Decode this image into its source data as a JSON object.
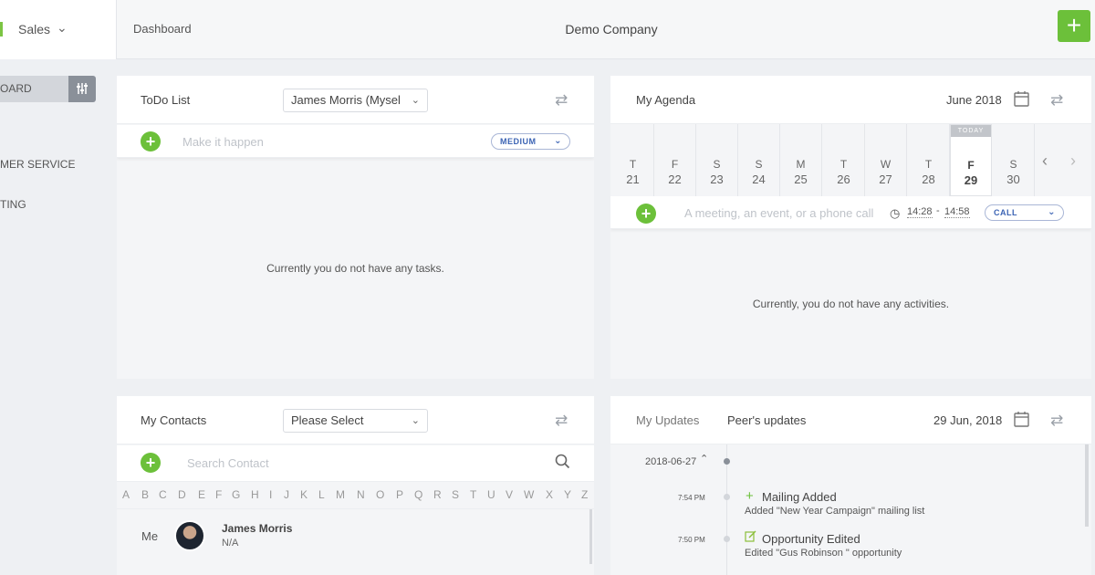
{
  "header": {
    "module": "Sales",
    "breadcrumb": "Dashboard",
    "company": "Demo Company",
    "add_label": "+"
  },
  "sidebar": {
    "active": "OARD",
    "items": [
      "MER SERVICE",
      "TING"
    ]
  },
  "todo": {
    "title": "ToDo List",
    "owner": "James Morris (Mysel",
    "placeholder": "Make it happen",
    "priority": "MEDIUM",
    "empty": "Currently you do not have any tasks."
  },
  "agenda": {
    "title": "My Agenda",
    "month": "June 2018",
    "today_label": "TODAY",
    "days": [
      {
        "name": "T",
        "num": "21"
      },
      {
        "name": "F",
        "num": "22"
      },
      {
        "name": "S",
        "num": "23"
      },
      {
        "name": "S",
        "num": "24"
      },
      {
        "name": "M",
        "num": "25"
      },
      {
        "name": "T",
        "num": "26"
      },
      {
        "name": "W",
        "num": "27"
      },
      {
        "name": "T",
        "num": "28"
      },
      {
        "name": "F",
        "num": "29"
      },
      {
        "name": "S",
        "num": "30"
      }
    ],
    "placeholder": "A meeting, an event, or a phone call",
    "time_from": "14:28",
    "time_sep": "-",
    "time_to": "14:58",
    "type": "CALL",
    "empty": "Currently, you do not have any activities."
  },
  "contacts": {
    "title": "My Contacts",
    "select": "Please Select",
    "search_placeholder": "Search Contact",
    "letters": [
      "A",
      "B",
      "C",
      "D",
      "E",
      "F",
      "G",
      "H",
      "I",
      "J",
      "K",
      "L",
      "M",
      "N",
      "O",
      "P",
      "Q",
      "R",
      "S",
      "T",
      "U",
      "V",
      "W",
      "X",
      "Y",
      "Z"
    ],
    "row_label": "Me",
    "name": "James Morris",
    "detail": "N/A"
  },
  "updates": {
    "tab_mine": "My Updates",
    "tab_peers": "Peer's updates",
    "date": "29 Jun, 2018",
    "group_date": "2018-06-27",
    "items": [
      {
        "time": "7:54 PM",
        "title": "Mailing Added",
        "desc": "Added \"New Year Campaign\" mailing list"
      },
      {
        "time": "7:50 PM",
        "title": "Opportunity Edited",
        "desc": "Edited \"Gus Robinson \" opportunity"
      }
    ]
  }
}
